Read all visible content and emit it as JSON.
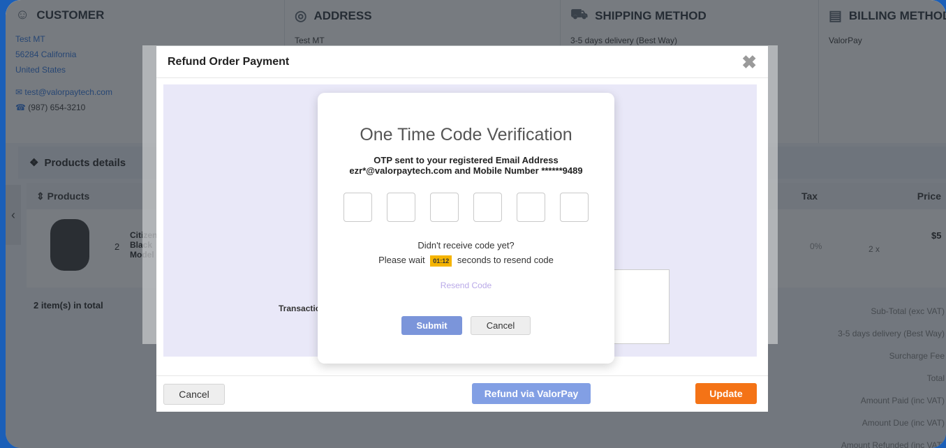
{
  "page": {
    "customer": {
      "title": "CUSTOMER",
      "icon": "user-icon",
      "name": "Test MT",
      "region": "56284 California",
      "country": "United States",
      "email": "test@valorpaytech.com",
      "phone": "(987) 654-3210"
    },
    "address": {
      "title": "ADDRESS",
      "icon": "location-icon",
      "line": "Test MT"
    },
    "shipping": {
      "title": "SHIPPING METHOD",
      "icon": "truck-icon",
      "line": "3-5 days delivery (Best Way)"
    },
    "billing": {
      "title": "BILLING METHOD",
      "icon": "receipt-icon",
      "line": "ValorPay"
    },
    "products": {
      "bar_title": "Products details",
      "col_products": "Products",
      "col_tax": "Tax",
      "col_price": "Price",
      "row": {
        "qty": "2",
        "name": "Citizen Black Model",
        "tax": "0%",
        "price": "$5",
        "qty_price": "2 x"
      },
      "items_total": "2 item(s) in total"
    },
    "totals": [
      "Sub-Total (exc VAT)",
      "3-5 days delivery (Best Way)",
      "Surcharge Fee",
      "Total",
      "Amount Paid (inc VAT)",
      "Amount Due (inc VAT)",
      "Amount Refunded (inc VAT)"
    ]
  },
  "refund_modal": {
    "title": "Refund Order Payment",
    "transaction_label": "Transaction",
    "cancel": "Cancel",
    "refund_valor": "Refund via ValorPay",
    "update": "Update"
  },
  "otp": {
    "title": "One Time Code Verification",
    "message": "OTP sent to your registered Email Address ezr*@valorpaytech.com and Mobile Number ******9489",
    "question": "Didn't receive code yet?",
    "wait_prefix": "Please wait",
    "timer": "01:12",
    "wait_suffix": "seconds to resend code",
    "resend": "Resend Code",
    "submit": "Submit",
    "cancel": "Cancel",
    "digits": [
      "",
      "",
      "",
      "",
      "",
      ""
    ]
  },
  "colors": {
    "frame": "#1b5fb8",
    "update": "#f47316",
    "timer": "#f5b400",
    "submit": "#7b95da",
    "link": "#3d7ee0"
  }
}
